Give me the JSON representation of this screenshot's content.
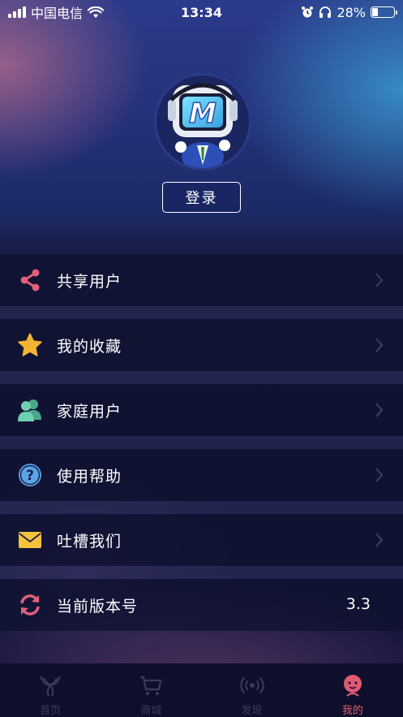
{
  "status_bar": {
    "carrier": "中国电信",
    "time": "13:34",
    "battery": "28%",
    "battery_level": 0.28
  },
  "profile": {
    "login_label": "登录"
  },
  "menu": [
    {
      "label": "共享用户",
      "icon": "share-icon"
    },
    {
      "label": "我的收藏",
      "icon": "star-icon"
    },
    {
      "label": "家庭用户",
      "icon": "family-users-icon"
    },
    {
      "label": "使用帮助",
      "icon": "help-icon"
    },
    {
      "label": "吐槽我们",
      "icon": "mail-icon"
    },
    {
      "label": "当前版本号",
      "icon": "refresh-icon",
      "value": "3.3"
    }
  ],
  "tabbar": [
    {
      "label": "首页",
      "icon": "home-logo-icon"
    },
    {
      "label": "商城",
      "icon": "cart-icon"
    },
    {
      "label": "发现",
      "icon": "radio-signal-icon"
    },
    {
      "label": "我的",
      "icon": "profile-icon",
      "active": true
    }
  ],
  "colors": {
    "accent": "#e05a72",
    "star": "#f3b531",
    "family": "#5dbb9c",
    "help": "#5aa3e8",
    "mail": "#f5c23b",
    "share": "#e0607a"
  }
}
